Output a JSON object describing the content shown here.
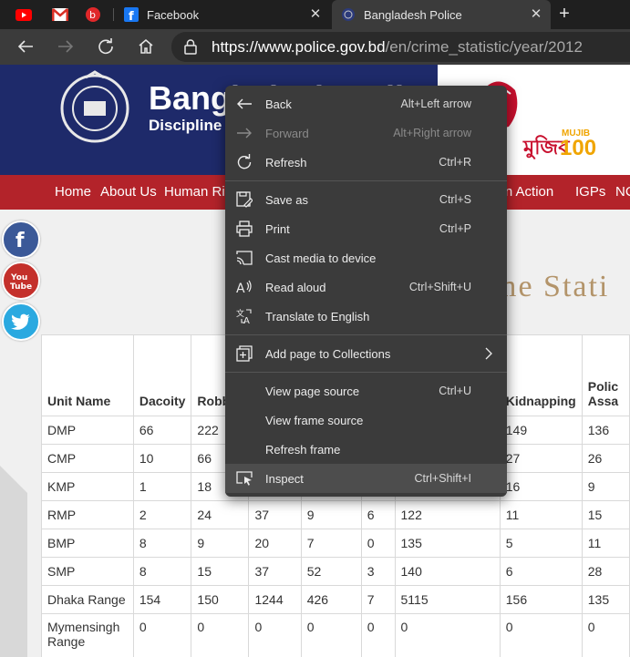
{
  "browser": {
    "tabs": [
      {
        "title": "Facebook",
        "active": false
      },
      {
        "title": "Bangladesh Police",
        "active": true
      }
    ],
    "address": {
      "scheme": "https://",
      "host": "www.police.gov.bd",
      "path": "/en/crime_statistic/year/2012"
    }
  },
  "site": {
    "title": "Bangladesh Poli",
    "subtitle": "Discipline S",
    "mujib_bangla": "মুজিব",
    "mujib_en": "MUJIB",
    "mujib_100": "100",
    "nav": [
      "Home",
      "About Us",
      "Human Rig",
      "e in Action",
      "IGPs",
      "NC"
    ],
    "heading": "me Stati"
  },
  "table": {
    "headers": [
      "Unit Name",
      "Dacoity",
      "Robb",
      "",
      "",
      "",
      "",
      "Kidnapping",
      "Polic Assa"
    ],
    "rows": [
      [
        "DMP",
        "66",
        "222",
        "",
        "",
        "",
        "",
        "149",
        "136"
      ],
      [
        "CMP",
        "10",
        "66",
        "",
        "",
        "",
        "",
        "27",
        "26"
      ],
      [
        "KMP",
        "1",
        "18",
        "",
        "",
        "",
        "",
        "16",
        "9"
      ],
      [
        "RMP",
        "2",
        "24",
        "37",
        "9",
        "6",
        "122",
        "11",
        "15"
      ],
      [
        "BMP",
        "8",
        "9",
        "20",
        "7",
        "0",
        "135",
        "5",
        "11"
      ],
      [
        "SMP",
        "8",
        "15",
        "37",
        "52",
        "3",
        "140",
        "6",
        "28"
      ],
      [
        "Dhaka Range",
        "154",
        "150",
        "1244",
        "426",
        "7",
        "5115",
        "156",
        "135"
      ],
      [
        "Mymensingh Range",
        "0",
        "0",
        "0",
        "0",
        "0",
        "0",
        "0",
        "0"
      ]
    ]
  },
  "context_menu": {
    "items": [
      {
        "label": "Back",
        "shortcut": "Alt+Left arrow",
        "icon": "arrow-left-icon"
      },
      {
        "label": "Forward",
        "shortcut": "Alt+Right arrow",
        "icon": "arrow-right-icon",
        "disabled": true
      },
      {
        "label": "Refresh",
        "shortcut": "Ctrl+R",
        "icon": "refresh-icon"
      },
      {
        "label": "Save as",
        "shortcut": "Ctrl+S",
        "icon": "save-as-icon"
      },
      {
        "label": "Print",
        "shortcut": "Ctrl+P",
        "icon": "printer-icon"
      },
      {
        "label": "Cast media to device",
        "shortcut": "",
        "icon": "cast-icon"
      },
      {
        "label": "Read aloud",
        "shortcut": "Ctrl+Shift+U",
        "icon": "read-aloud-icon"
      },
      {
        "label": "Translate to English",
        "shortcut": "",
        "icon": "translate-icon"
      },
      {
        "label": "Add page to Collections",
        "shortcut": "",
        "icon": "collections-icon"
      },
      {
        "label": "View page source",
        "shortcut": "Ctrl+U",
        "icon": ""
      },
      {
        "label": "View frame source",
        "shortcut": "",
        "icon": ""
      },
      {
        "label": "Refresh frame",
        "shortcut": "",
        "icon": ""
      },
      {
        "label": "Inspect",
        "shortcut": "Ctrl+Shift+I",
        "icon": "inspect-icon",
        "highlighted": true
      }
    ]
  }
}
